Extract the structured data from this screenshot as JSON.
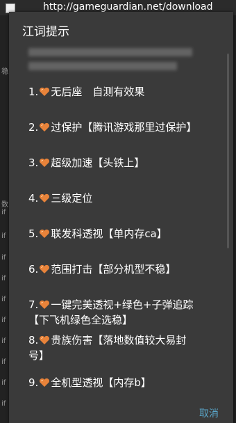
{
  "topbar": {
    "url": "http://gameguardian.net/download"
  },
  "background": {
    "labels": [
      "稳",
      "数",
      "if",
      "if",
      "if",
      "if",
      "if",
      "if",
      "if",
      "if",
      "if",
      "if",
      "if",
      "if",
      "if"
    ]
  },
  "dialog": {
    "title": "江词提示",
    "items": [
      {
        "num": "1.",
        "text": "无后座　自测有效果"
      },
      {
        "num": "2.",
        "text": "过保护【腾讯游戏那里过保护】"
      },
      {
        "num": "3.",
        "text": "超级加速【头铁上】"
      },
      {
        "num": "4.",
        "text": "三级定位"
      },
      {
        "num": "5.",
        "text": "联发科透视【单内存ca】"
      },
      {
        "num": "6.",
        "text": "范围打击【部分机型不稳】"
      },
      {
        "num": "7.",
        "text": "一键完美透视+绿色+子弹追踪",
        "text2": "【下飞机绿色全选稳】"
      },
      {
        "num": "8.",
        "text": "贵族伤害【落地数值较大易封",
        "text2": "号】"
      },
      {
        "num": "9.",
        "text": "全机型透视【内存b】"
      }
    ],
    "cancel_label": "取消"
  },
  "colors": {
    "dialog_bg": "#3a3a3a",
    "accent": "#5aa6c9",
    "heart": "#e8833a"
  }
}
